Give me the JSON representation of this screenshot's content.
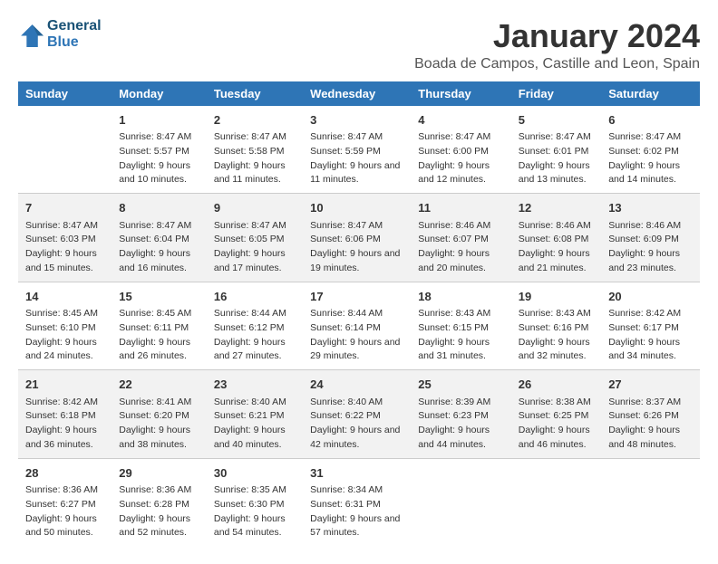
{
  "app": {
    "name": "GeneralBlue",
    "logo_text_line1": "General",
    "logo_text_line2": "Blue"
  },
  "header": {
    "month_year": "January 2024",
    "location": "Boada de Campos, Castille and Leon, Spain"
  },
  "weekdays": [
    "Sunday",
    "Monday",
    "Tuesday",
    "Wednesday",
    "Thursday",
    "Friday",
    "Saturday"
  ],
  "weeks": [
    [
      {
        "day": "",
        "sunrise": "",
        "sunset": "",
        "daylight": ""
      },
      {
        "day": "1",
        "sunrise": "Sunrise: 8:47 AM",
        "sunset": "Sunset: 5:57 PM",
        "daylight": "Daylight: 9 hours and 10 minutes."
      },
      {
        "day": "2",
        "sunrise": "Sunrise: 8:47 AM",
        "sunset": "Sunset: 5:58 PM",
        "daylight": "Daylight: 9 hours and 11 minutes."
      },
      {
        "day": "3",
        "sunrise": "Sunrise: 8:47 AM",
        "sunset": "Sunset: 5:59 PM",
        "daylight": "Daylight: 9 hours and 11 minutes."
      },
      {
        "day": "4",
        "sunrise": "Sunrise: 8:47 AM",
        "sunset": "Sunset: 6:00 PM",
        "daylight": "Daylight: 9 hours and 12 minutes."
      },
      {
        "day": "5",
        "sunrise": "Sunrise: 8:47 AM",
        "sunset": "Sunset: 6:01 PM",
        "daylight": "Daylight: 9 hours and 13 minutes."
      },
      {
        "day": "6",
        "sunrise": "Sunrise: 8:47 AM",
        "sunset": "Sunset: 6:02 PM",
        "daylight": "Daylight: 9 hours and 14 minutes."
      }
    ],
    [
      {
        "day": "7",
        "sunrise": "Sunrise: 8:47 AM",
        "sunset": "Sunset: 6:03 PM",
        "daylight": "Daylight: 9 hours and 15 minutes."
      },
      {
        "day": "8",
        "sunrise": "Sunrise: 8:47 AM",
        "sunset": "Sunset: 6:04 PM",
        "daylight": "Daylight: 9 hours and 16 minutes."
      },
      {
        "day": "9",
        "sunrise": "Sunrise: 8:47 AM",
        "sunset": "Sunset: 6:05 PM",
        "daylight": "Daylight: 9 hours and 17 minutes."
      },
      {
        "day": "10",
        "sunrise": "Sunrise: 8:47 AM",
        "sunset": "Sunset: 6:06 PM",
        "daylight": "Daylight: 9 hours and 19 minutes."
      },
      {
        "day": "11",
        "sunrise": "Sunrise: 8:46 AM",
        "sunset": "Sunset: 6:07 PM",
        "daylight": "Daylight: 9 hours and 20 minutes."
      },
      {
        "day": "12",
        "sunrise": "Sunrise: 8:46 AM",
        "sunset": "Sunset: 6:08 PM",
        "daylight": "Daylight: 9 hours and 21 minutes."
      },
      {
        "day": "13",
        "sunrise": "Sunrise: 8:46 AM",
        "sunset": "Sunset: 6:09 PM",
        "daylight": "Daylight: 9 hours and 23 minutes."
      }
    ],
    [
      {
        "day": "14",
        "sunrise": "Sunrise: 8:45 AM",
        "sunset": "Sunset: 6:10 PM",
        "daylight": "Daylight: 9 hours and 24 minutes."
      },
      {
        "day": "15",
        "sunrise": "Sunrise: 8:45 AM",
        "sunset": "Sunset: 6:11 PM",
        "daylight": "Daylight: 9 hours and 26 minutes."
      },
      {
        "day": "16",
        "sunrise": "Sunrise: 8:44 AM",
        "sunset": "Sunset: 6:12 PM",
        "daylight": "Daylight: 9 hours and 27 minutes."
      },
      {
        "day": "17",
        "sunrise": "Sunrise: 8:44 AM",
        "sunset": "Sunset: 6:14 PM",
        "daylight": "Daylight: 9 hours and 29 minutes."
      },
      {
        "day": "18",
        "sunrise": "Sunrise: 8:43 AM",
        "sunset": "Sunset: 6:15 PM",
        "daylight": "Daylight: 9 hours and 31 minutes."
      },
      {
        "day": "19",
        "sunrise": "Sunrise: 8:43 AM",
        "sunset": "Sunset: 6:16 PM",
        "daylight": "Daylight: 9 hours and 32 minutes."
      },
      {
        "day": "20",
        "sunrise": "Sunrise: 8:42 AM",
        "sunset": "Sunset: 6:17 PM",
        "daylight": "Daylight: 9 hours and 34 minutes."
      }
    ],
    [
      {
        "day": "21",
        "sunrise": "Sunrise: 8:42 AM",
        "sunset": "Sunset: 6:18 PM",
        "daylight": "Daylight: 9 hours and 36 minutes."
      },
      {
        "day": "22",
        "sunrise": "Sunrise: 8:41 AM",
        "sunset": "Sunset: 6:20 PM",
        "daylight": "Daylight: 9 hours and 38 minutes."
      },
      {
        "day": "23",
        "sunrise": "Sunrise: 8:40 AM",
        "sunset": "Sunset: 6:21 PM",
        "daylight": "Daylight: 9 hours and 40 minutes."
      },
      {
        "day": "24",
        "sunrise": "Sunrise: 8:40 AM",
        "sunset": "Sunset: 6:22 PM",
        "daylight": "Daylight: 9 hours and 42 minutes."
      },
      {
        "day": "25",
        "sunrise": "Sunrise: 8:39 AM",
        "sunset": "Sunset: 6:23 PM",
        "daylight": "Daylight: 9 hours and 44 minutes."
      },
      {
        "day": "26",
        "sunrise": "Sunrise: 8:38 AM",
        "sunset": "Sunset: 6:25 PM",
        "daylight": "Daylight: 9 hours and 46 minutes."
      },
      {
        "day": "27",
        "sunrise": "Sunrise: 8:37 AM",
        "sunset": "Sunset: 6:26 PM",
        "daylight": "Daylight: 9 hours and 48 minutes."
      }
    ],
    [
      {
        "day": "28",
        "sunrise": "Sunrise: 8:36 AM",
        "sunset": "Sunset: 6:27 PM",
        "daylight": "Daylight: 9 hours and 50 minutes."
      },
      {
        "day": "29",
        "sunrise": "Sunrise: 8:36 AM",
        "sunset": "Sunset: 6:28 PM",
        "daylight": "Daylight: 9 hours and 52 minutes."
      },
      {
        "day": "30",
        "sunrise": "Sunrise: 8:35 AM",
        "sunset": "Sunset: 6:30 PM",
        "daylight": "Daylight: 9 hours and 54 minutes."
      },
      {
        "day": "31",
        "sunrise": "Sunrise: 8:34 AM",
        "sunset": "Sunset: 6:31 PM",
        "daylight": "Daylight: 9 hours and 57 minutes."
      },
      {
        "day": "",
        "sunrise": "",
        "sunset": "",
        "daylight": ""
      },
      {
        "day": "",
        "sunrise": "",
        "sunset": "",
        "daylight": ""
      },
      {
        "day": "",
        "sunrise": "",
        "sunset": "",
        "daylight": ""
      }
    ]
  ]
}
